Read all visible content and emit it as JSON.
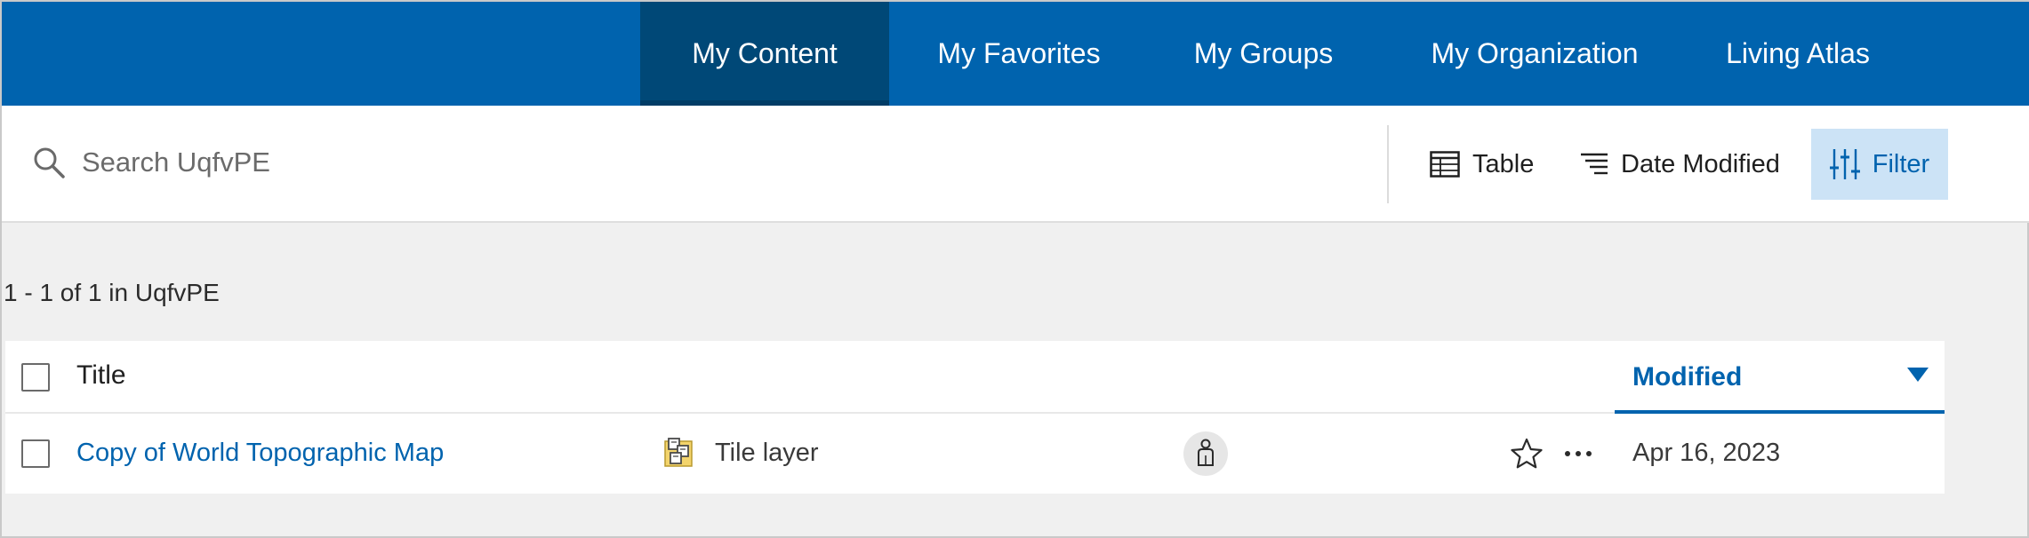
{
  "nav": {
    "tabs": [
      {
        "label": "My Content",
        "active": true
      },
      {
        "label": "My Favorites",
        "active": false
      },
      {
        "label": "My Groups",
        "active": false
      },
      {
        "label": "My Organization",
        "active": false
      },
      {
        "label": "Living Atlas",
        "active": false
      }
    ]
  },
  "toolbar": {
    "search_placeholder": "Search UqfvPE",
    "search_value": "",
    "table_label": "Table",
    "sort_label": "Date Modified",
    "filter_label": "Filter"
  },
  "results": {
    "count_text": "1 - 1 of 1 in UqfvPE"
  },
  "table": {
    "columns": {
      "title": "Title",
      "modified": "Modified"
    },
    "sort": "descending",
    "rows": [
      {
        "title": "Copy of World Topographic Map",
        "type": "Tile layer",
        "type_icon": "tile-layer-icon",
        "sharing_icon": "owner-only-icon",
        "modified": "Apr 16, 2023",
        "favorited": false,
        "selected": false
      }
    ]
  },
  "colors": {
    "nav_background": "#0063ae",
    "nav_active": "#004877",
    "accent": "#0063ae",
    "filter_active_bg": "#cce3f6",
    "page_background": "#f0f0f0"
  }
}
